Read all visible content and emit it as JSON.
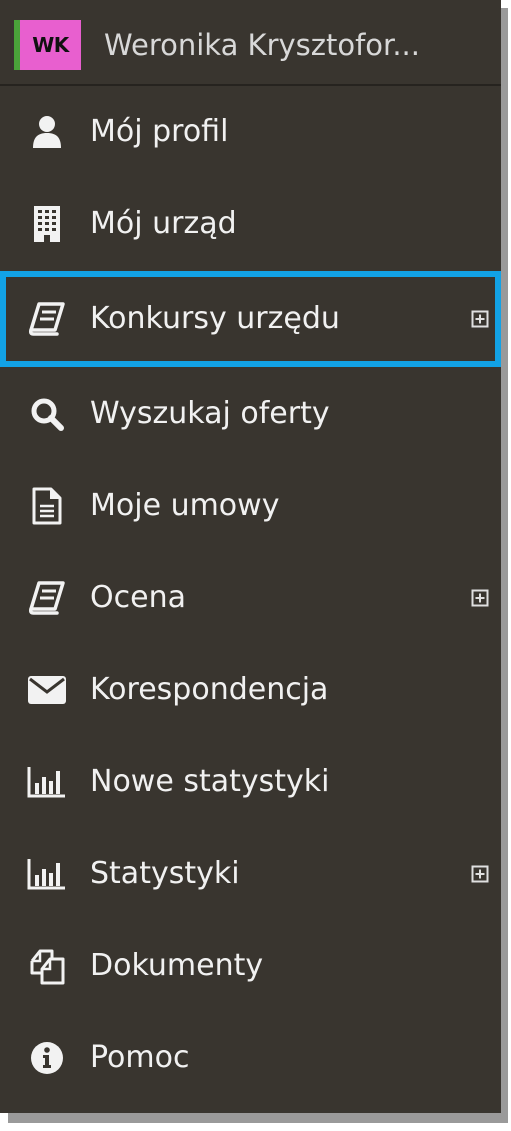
{
  "user": {
    "initials": "WK",
    "name": "Weronika Krysztofor..."
  },
  "menu": [
    {
      "label": "Mój profil",
      "icon": "user-icon",
      "expandable": false,
      "active": false
    },
    {
      "label": "Mój urząd",
      "icon": "building-icon",
      "expandable": false,
      "active": false
    },
    {
      "label": "Konkursy urzędu",
      "icon": "book-icon",
      "expandable": true,
      "active": true
    },
    {
      "label": "Wyszukaj oferty",
      "icon": "search-icon",
      "expandable": false,
      "active": false
    },
    {
      "label": "Moje umowy",
      "icon": "document-icon",
      "expandable": false,
      "active": false
    },
    {
      "label": "Ocena",
      "icon": "book-icon",
      "expandable": true,
      "active": false
    },
    {
      "label": "Korespondencja",
      "icon": "envelope-icon",
      "expandable": false,
      "active": false
    },
    {
      "label": "Nowe statystyki",
      "icon": "bar-chart-icon",
      "expandable": false,
      "active": false
    },
    {
      "label": "Statystyki",
      "icon": "bar-chart-icon",
      "expandable": true,
      "active": false
    },
    {
      "label": "Dokumenty",
      "icon": "copy-documents-icon",
      "expandable": false,
      "active": false
    },
    {
      "label": "Pomoc",
      "icon": "info-icon",
      "expandable": false,
      "active": false
    }
  ],
  "colors": {
    "sidebar_background": "#39352f",
    "active_border": "#12a2e6",
    "avatar_background": "#e85fcf",
    "avatar_stripe": "#4aa33a",
    "text": "#f1f1f1"
  }
}
